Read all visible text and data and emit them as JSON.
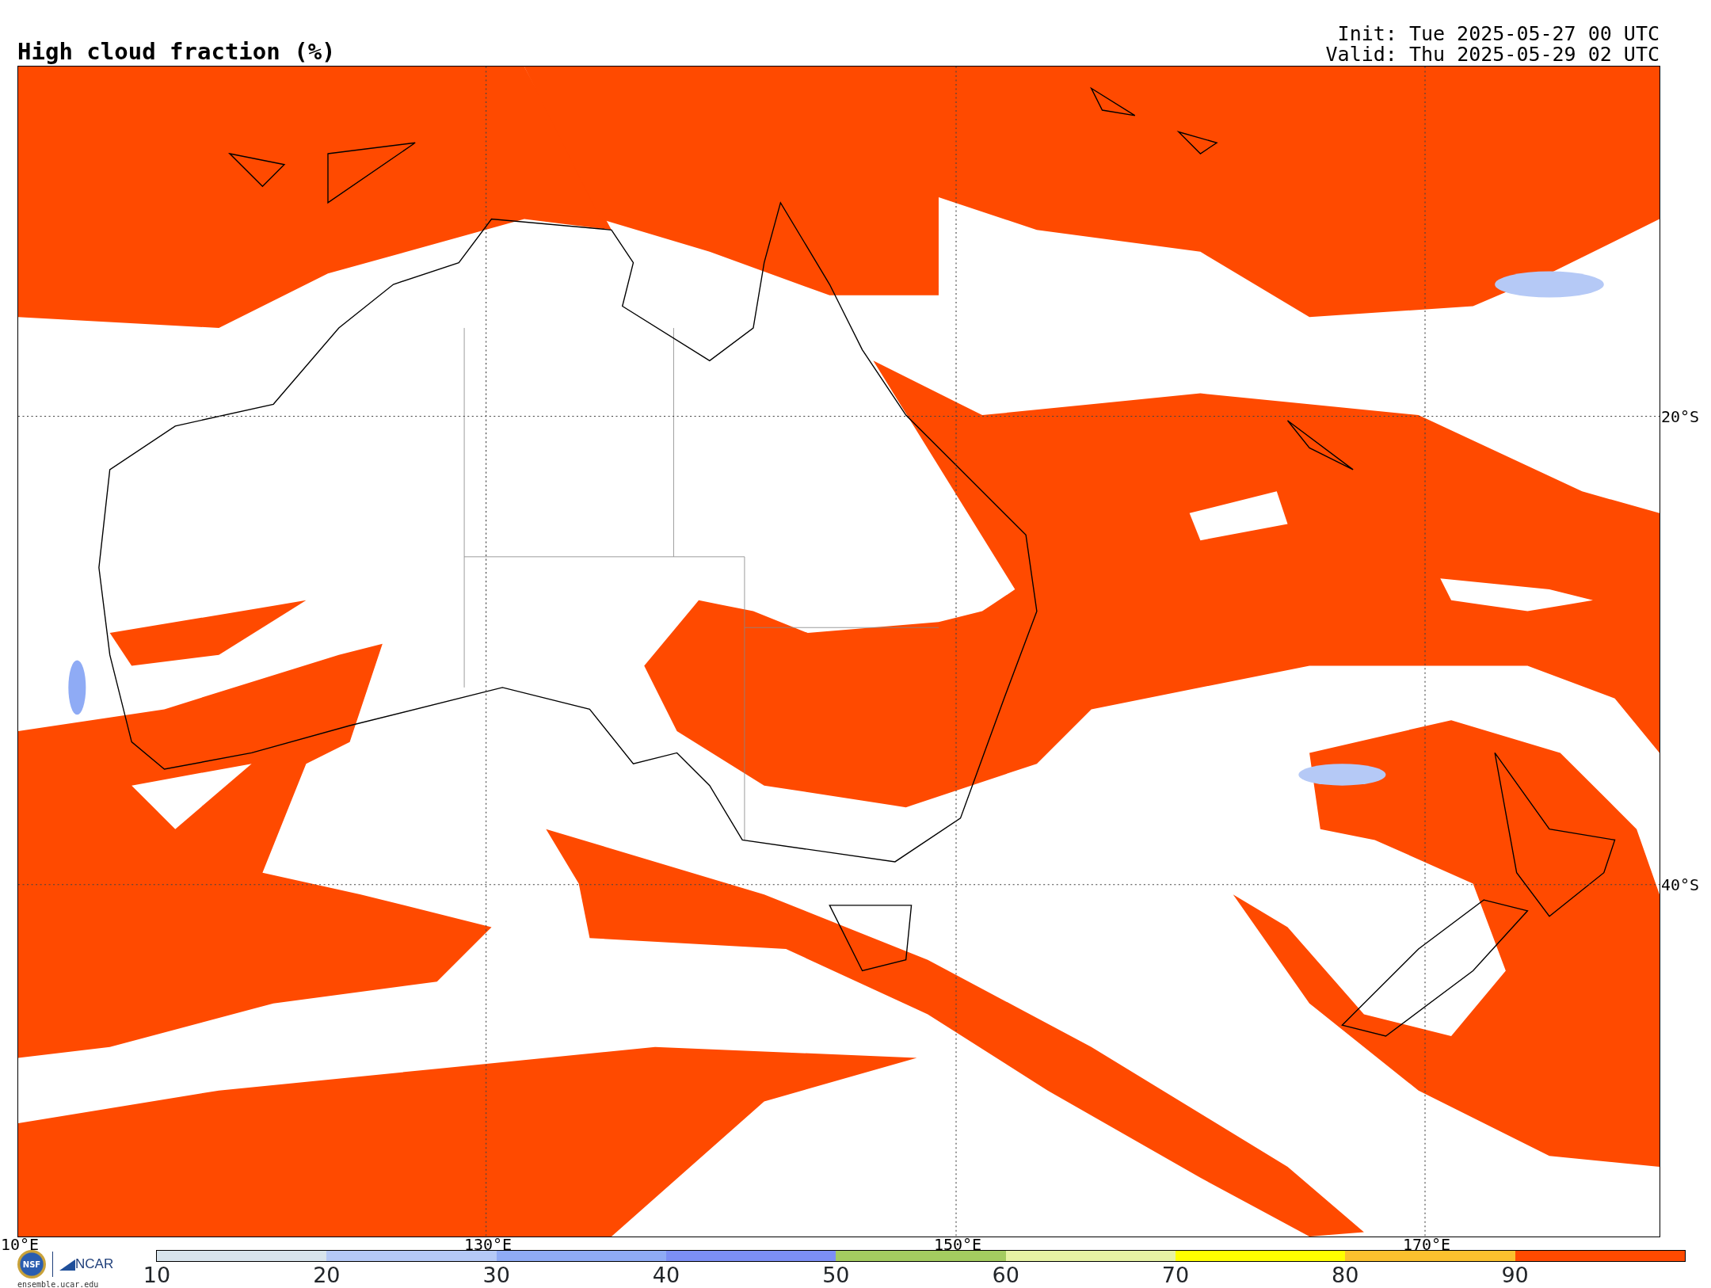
{
  "title": "High cloud fraction (%)",
  "init": "Init: Tue 2025-05-27 00 UTC",
  "valid": "Valid: Thu 2025-05-29 02 UTC",
  "map": {
    "lon_labels": [
      "10°E",
      "130°E",
      "150°E",
      "170°E"
    ],
    "lat_labels": [
      "20°S",
      "40°S"
    ]
  },
  "logos": {
    "nsf": "NSF",
    "ncar": "NCAR",
    "site": "ensemble.ucar.edu"
  },
  "colorbar": {
    "segments": [
      {
        "tick": "10",
        "color": "#d8e4ec"
      },
      {
        "tick": "20",
        "color": "#b5c9f6"
      },
      {
        "tick": "30",
        "color": "#8fabf5"
      },
      {
        "tick": "40",
        "color": "#7c8ff5"
      },
      {
        "tick": "50",
        "color": "#a4cc60"
      },
      {
        "tick": "60",
        "color": "#e7f3a4"
      },
      {
        "tick": "70",
        "color": "#ffff00"
      },
      {
        "tick": "80",
        "color": "#fbc12e"
      },
      {
        "tick": "90",
        "color": "#ff4a00"
      }
    ]
  }
}
